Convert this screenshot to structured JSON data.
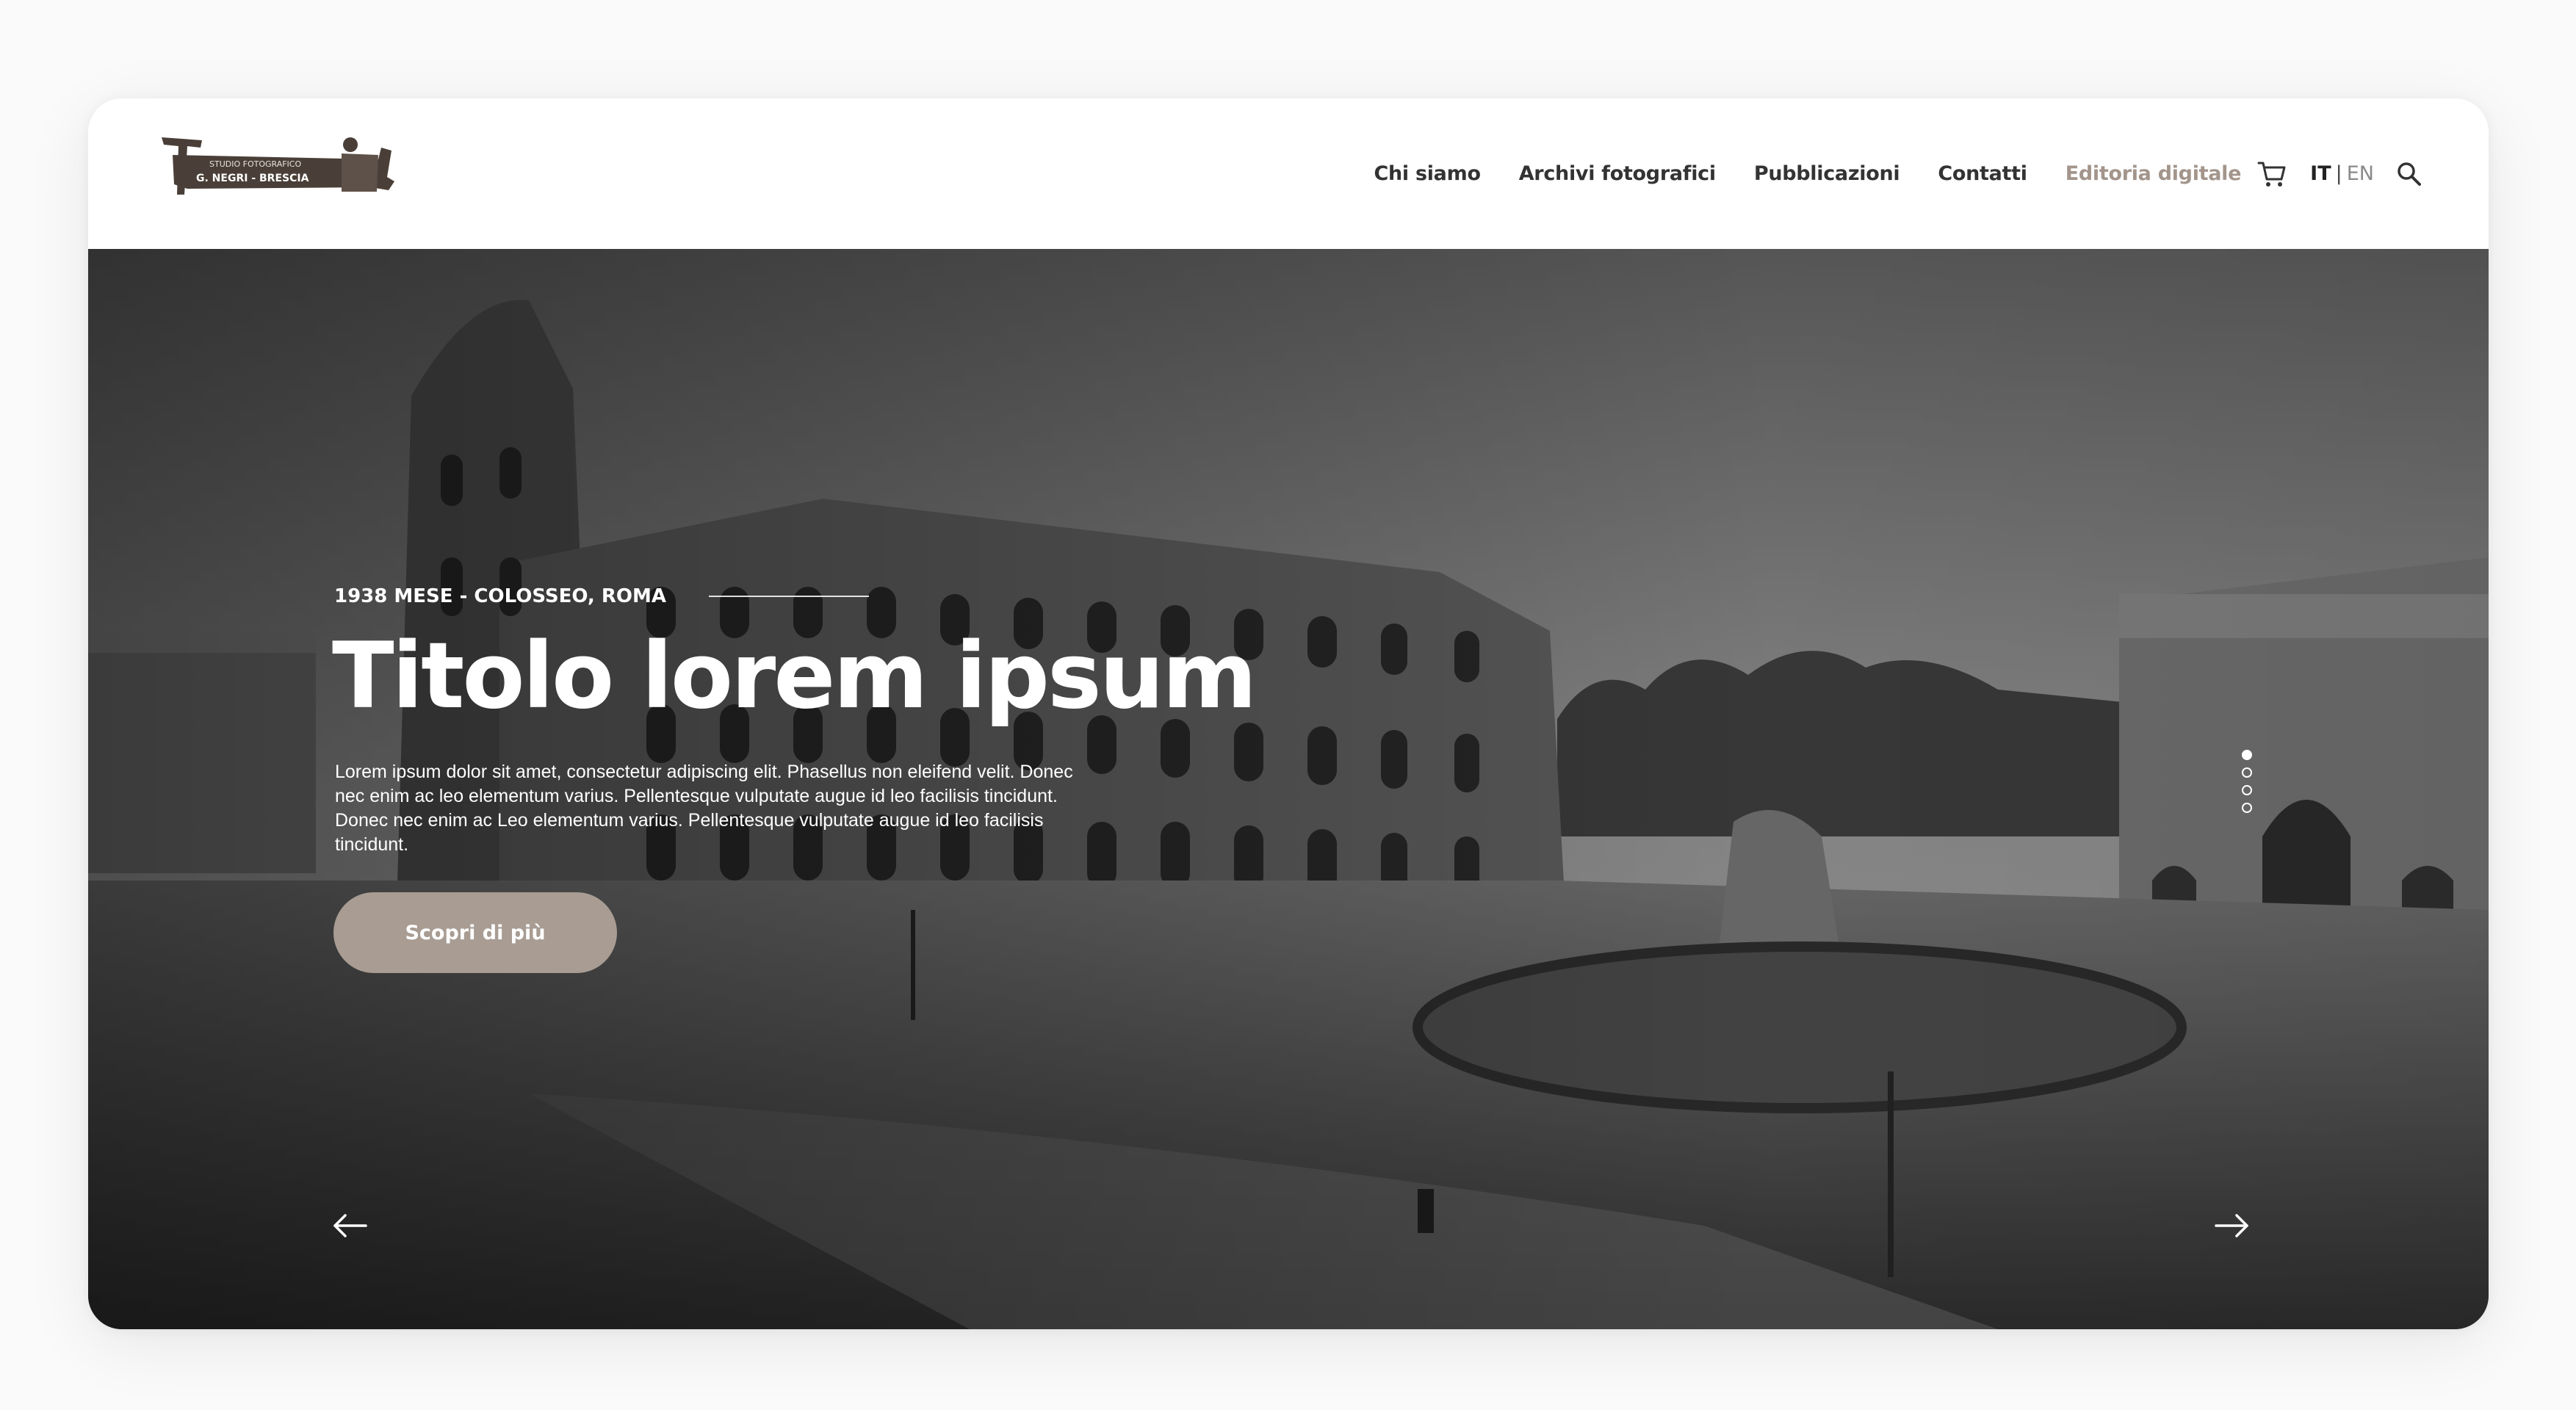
{
  "header": {
    "logo_alt": "Studio Fotografico G. Negri - Brescia",
    "logo_lines": [
      "STUDIO FOTOGRAFICO",
      "G. NEGRI - BRESCIA"
    ],
    "nav": [
      {
        "label": "Chi siamo"
      },
      {
        "label": "Archivi fotografici"
      },
      {
        "label": "Pubblicazioni"
      },
      {
        "label": "Contatti"
      },
      {
        "label": "Editoria digitale"
      }
    ],
    "lang_active": "IT",
    "lang_separator": "|",
    "lang_other": "EN",
    "icons": {
      "cart": "cart-icon",
      "search": "search-icon"
    }
  },
  "hero": {
    "eyebrow": "1938 MESE - COLOSSEO,  ROMA",
    "title": "Titolo lorem ipsum",
    "text": "Lorem ipsum dolor sit amet, consectetur adipiscing elit. Phasellus non eleifend velit. Donec nec enim ac leo elementum varius. Pellentesque vulputate augue id leo facilisis tincidunt. Donec nec enim ac Leo elementum varius. Pellentesque vulputate augue id leo facilisis tincidunt.",
    "cta_label": "Scopri di più",
    "slides_total": 4,
    "slide_active": 1,
    "icons": {
      "prev": "arrow-left-icon",
      "next": "arrow-right-icon"
    }
  },
  "colors": {
    "accent": "#a3958b",
    "button": "#a89c93",
    "text_dark": "#333333"
  }
}
